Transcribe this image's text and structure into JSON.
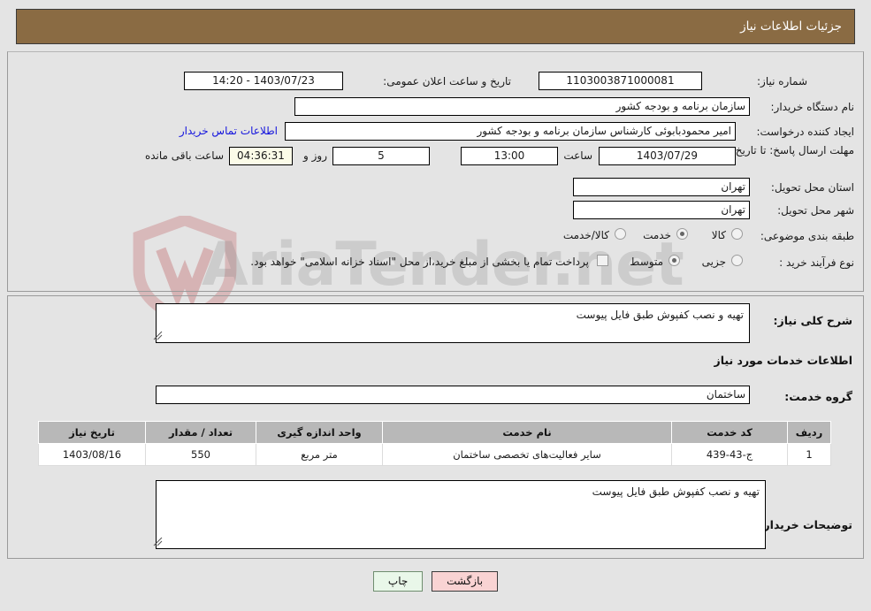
{
  "header": {
    "title": "جزئیات اطلاعات نیاز"
  },
  "form": {
    "need_number_label": "شماره نیاز:",
    "need_number_value": "1103003871000081",
    "announce_datetime_label": "تاریخ و ساعت اعلان عمومی:",
    "announce_datetime_value": "1403/07/23 - 14:20",
    "buyer_org_label": "نام دستگاه خریدار:",
    "buyer_org_value": "سازمان برنامه و بودجه کشور",
    "requester_label": "ایجاد کننده درخواست:",
    "requester_value": "امیر محمودبابوئی کارشناس سازمان برنامه و بودجه کشور",
    "contact_link": "اطلاعات تماس خریدار",
    "deadline_label": "مهلت ارسال پاسخ: تا تاریخ:",
    "deadline_date": "1403/07/29",
    "hour_label": "ساعت",
    "deadline_time": "13:00",
    "days_value": "5",
    "days_label": "روز و",
    "countdown_value": "04:36:31",
    "countdown_label": "ساعت باقی مانده",
    "province_label": "استان محل تحویل:",
    "province_value": "تهران",
    "city_label": "شهر محل تحویل:",
    "city_value": "تهران",
    "category_label": "طبقه بندی موضوعی:",
    "category_options": [
      {
        "label": "کالا",
        "selected": false
      },
      {
        "label": "خدمت",
        "selected": true
      },
      {
        "label": "کالا/خدمت",
        "selected": false
      }
    ],
    "process_label": "نوع فرآیند خرید :",
    "process_options": [
      {
        "label": "جزیی",
        "selected": false
      },
      {
        "label": "متوسط",
        "selected": true
      }
    ],
    "treasury_checkbox_label": "پرداخت تمام یا بخشی از مبلغ خرید،از محل \"اسناد خزانه اسلامی\" خواهد بود.",
    "treasury_checked": false
  },
  "detail": {
    "general_desc_label": "شرح کلی نیاز:",
    "general_desc_value": "تهیه و نصب کفپوش طبق فایل پیوست",
    "services_heading": "اطلاعات خدمات مورد نیاز",
    "service_group_label": "گروه خدمت:",
    "service_group_value": "ساختمان",
    "buyer_notes_label": "توضیحات خریدار:",
    "buyer_notes_value": "تهیه و نصب کفپوش طبق فایل پیوست"
  },
  "table": {
    "columns": [
      "ردیف",
      "کد خدمت",
      "نام خدمت",
      "واحد اندازه گیری",
      "تعداد / مقدار",
      "تاریخ نیاز"
    ],
    "rows": [
      {
        "index": "1",
        "code": "ج-43-439",
        "name": "سایر فعالیت‌های تخصصی ساختمان",
        "unit": "متر مربع",
        "quantity": "550",
        "need_date": "1403/08/16"
      }
    ]
  },
  "buttons": {
    "print": "چاپ",
    "back": "بازگشت"
  },
  "watermark": {
    "text": "AriaTender.net"
  },
  "colors": {
    "header_bg": "#8a6b43",
    "page_bg": "#e4e4e4",
    "link": "#1414dd",
    "timer_bg": "#fbfbe8",
    "table_header_bg": "#b8b8b8",
    "print_btn_bg": "#e9f7e9",
    "back_btn_bg": "#f9d3d3"
  }
}
